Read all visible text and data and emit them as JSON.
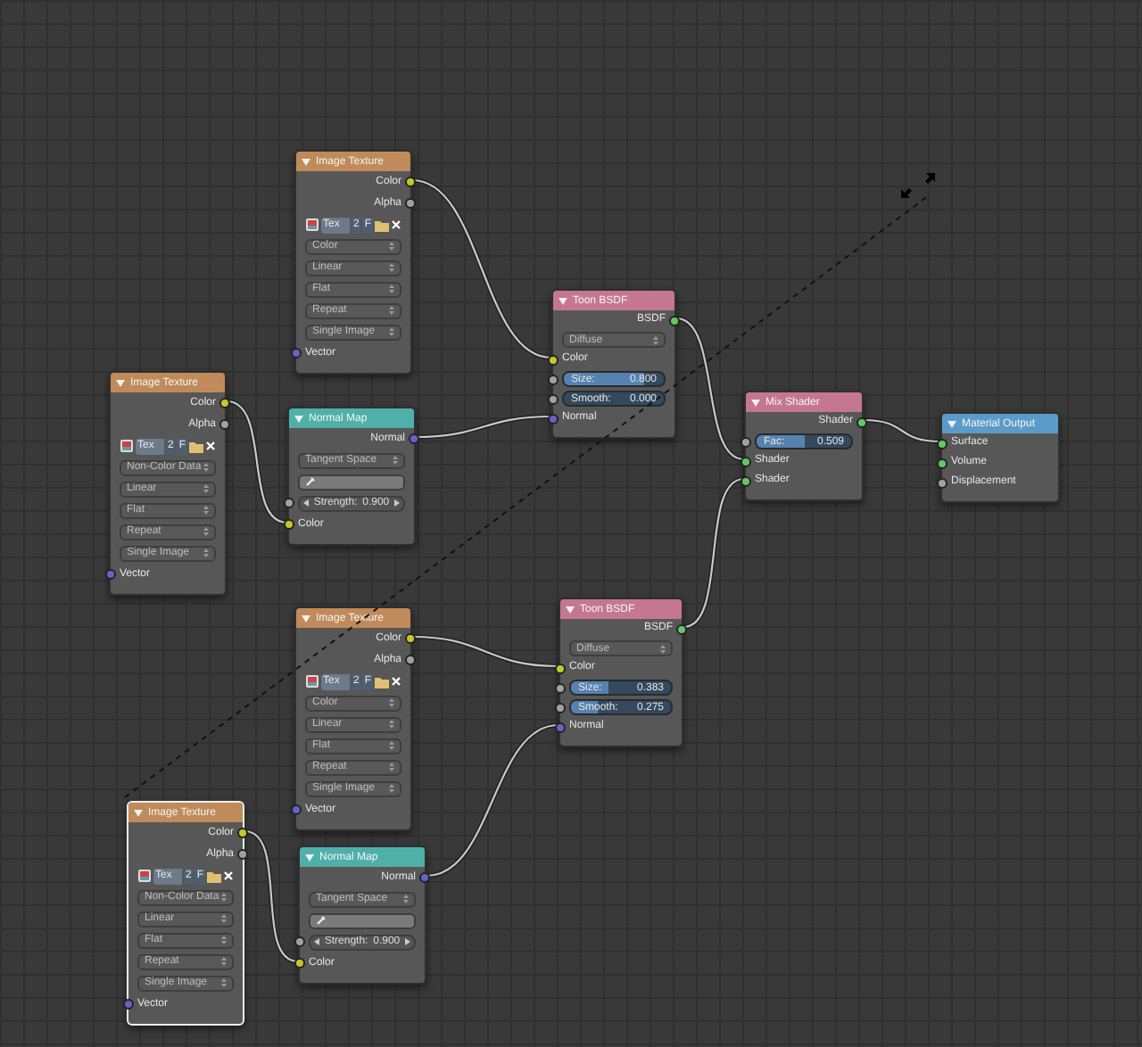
{
  "nodes": [
    {
      "kind": "image_texture",
      "title": "Image Texture",
      "selected": false,
      "rows": [
        {
          "kind": "output",
          "label": "Color",
          "color": "#c7c729"
        },
        {
          "kind": "output",
          "label": "Alpha",
          "color": "#a1a1a1"
        },
        {
          "kind": "image",
          "name": "Tex",
          "users": "2",
          "fake": "F"
        },
        {
          "kind": "dropdown",
          "value": "Color"
        },
        {
          "kind": "dropdown",
          "value": "Linear"
        },
        {
          "kind": "dropdown",
          "value": "Flat"
        },
        {
          "kind": "dropdown",
          "value": "Repeat"
        },
        {
          "kind": "dropdown",
          "value": "Single Image"
        },
        {
          "kind": "input",
          "label": "Vector",
          "color": "#6363c7"
        }
      ]
    },
    {
      "kind": "image_texture",
      "title": "Image Texture",
      "selected": false,
      "rows": [
        {
          "kind": "output",
          "label": "Color",
          "color": "#c7c729"
        },
        {
          "kind": "output",
          "label": "Alpha",
          "color": "#a1a1a1"
        },
        {
          "kind": "image",
          "name": "Tex",
          "users": "2",
          "fake": "F"
        },
        {
          "kind": "dropdown",
          "value": "Non-Color Data"
        },
        {
          "kind": "dropdown",
          "value": "Linear"
        },
        {
          "kind": "dropdown",
          "value": "Flat"
        },
        {
          "kind": "dropdown",
          "value": "Repeat"
        },
        {
          "kind": "dropdown",
          "value": "Single Image"
        },
        {
          "kind": "input",
          "label": "Vector",
          "color": "#6363c7"
        }
      ]
    },
    {
      "kind": "normal_map",
      "title": "Normal Map",
      "selected": false,
      "rows": [
        {
          "kind": "output",
          "label": "Normal",
          "color": "#6363c7"
        },
        {
          "kind": "dropdown",
          "value": "Tangent Space"
        },
        {
          "kind": "field"
        },
        {
          "kind": "number",
          "label": "Strength:",
          "value": "0.900",
          "color": "#a1a1a1"
        },
        {
          "kind": "input",
          "label": "Color",
          "color": "#c7c729"
        }
      ]
    },
    {
      "kind": "toon_bsdf",
      "title": "Toon BSDF",
      "selected": false,
      "rows": [
        {
          "kind": "output",
          "label": "BSDF",
          "color": "#63c763"
        },
        {
          "kind": "dropdown",
          "value": "Diffuse"
        },
        {
          "kind": "input",
          "label": "Color",
          "color": "#c7c729"
        },
        {
          "kind": "slider",
          "label": "Size:",
          "value": "0.800",
          "level": 0.8,
          "color": "#a1a1a1"
        },
        {
          "kind": "slider",
          "label": "Smooth:",
          "value": "0.000",
          "level": 0,
          "color": "#a1a1a1"
        },
        {
          "kind": "input",
          "label": "Normal",
          "color": "#6363c7"
        }
      ]
    },
    {
      "kind": "mix_shader",
      "title": "Mix Shader",
      "selected": false,
      "rows": [
        {
          "kind": "output",
          "label": "Shader",
          "color": "#63c763"
        },
        {
          "kind": "slider",
          "label": "Fac:",
          "value": "0.509",
          "level": 0.509,
          "color": "#a1a1a1"
        },
        {
          "kind": "input",
          "label": "Shader",
          "color": "#63c763"
        },
        {
          "kind": "input",
          "label": "Shader",
          "color": "#63c763"
        }
      ]
    },
    {
      "kind": "material_output",
      "title": "Material Output",
      "selected": false,
      "rows": [
        {
          "kind": "input",
          "label": "Surface",
          "color": "#63c763"
        },
        {
          "kind": "input",
          "label": "Volume",
          "color": "#63c763"
        },
        {
          "kind": "input",
          "label": "Displacement",
          "color": "#a1a1a1"
        }
      ]
    },
    {
      "kind": "image_texture",
      "title": "Image Texture",
      "selected": false,
      "rows": [
        {
          "kind": "output",
          "label": "Color",
          "color": "#c7c729"
        },
        {
          "kind": "output",
          "label": "Alpha",
          "color": "#a1a1a1"
        },
        {
          "kind": "image",
          "name": "Tex",
          "users": "2",
          "fake": "F"
        },
        {
          "kind": "dropdown",
          "value": "Color"
        },
        {
          "kind": "dropdown",
          "value": "Linear"
        },
        {
          "kind": "dropdown",
          "value": "Flat"
        },
        {
          "kind": "dropdown",
          "value": "Repeat"
        },
        {
          "kind": "dropdown",
          "value": "Single Image"
        },
        {
          "kind": "input",
          "label": "Vector",
          "color": "#6363c7"
        }
      ]
    },
    {
      "kind": "toon_bsdf",
      "title": "Toon BSDF",
      "selected": false,
      "rows": [
        {
          "kind": "output",
          "label": "BSDF",
          "color": "#63c763"
        },
        {
          "kind": "dropdown",
          "value": "Diffuse"
        },
        {
          "kind": "input",
          "label": "Color",
          "color": "#c7c729"
        },
        {
          "kind": "slider",
          "label": "Size:",
          "value": "0.383",
          "level": 0.383,
          "color": "#a1a1a1"
        },
        {
          "kind": "slider",
          "label": "Smooth:",
          "value": "0.275",
          "level": 0.275,
          "color": "#a1a1a1"
        },
        {
          "kind": "input",
          "label": "Normal",
          "color": "#6363c7"
        }
      ]
    },
    {
      "kind": "image_texture",
      "title": "Image Texture",
      "selected": true,
      "rows": [
        {
          "kind": "output",
          "label": "Color",
          "color": "#c7c729"
        },
        {
          "kind": "output",
          "label": "Alpha",
          "color": "#a1a1a1"
        },
        {
          "kind": "image",
          "name": "Tex",
          "users": "2",
          "fake": "F"
        },
        {
          "kind": "dropdown",
          "value": "Non-Color Data"
        },
        {
          "kind": "dropdown",
          "value": "Linear"
        },
        {
          "kind": "dropdown",
          "value": "Flat"
        },
        {
          "kind": "dropdown",
          "value": "Repeat"
        },
        {
          "kind": "dropdown",
          "value": "Single Image"
        },
        {
          "kind": "input",
          "label": "Vector",
          "color": "#6363c7"
        }
      ]
    },
    {
      "kind": "normal_map",
      "title": "Normal Map",
      "selected": false,
      "rows": [
        {
          "kind": "output",
          "label": "Normal",
          "color": "#6363c7"
        },
        {
          "kind": "dropdown",
          "value": "Tangent Space"
        },
        {
          "kind": "field"
        },
        {
          "kind": "number",
          "label": "Strength:",
          "value": "0.900",
          "color": "#a1a1a1"
        },
        {
          "kind": "input",
          "label": "Color",
          "color": "#c7c729"
        }
      ]
    }
  ]
}
